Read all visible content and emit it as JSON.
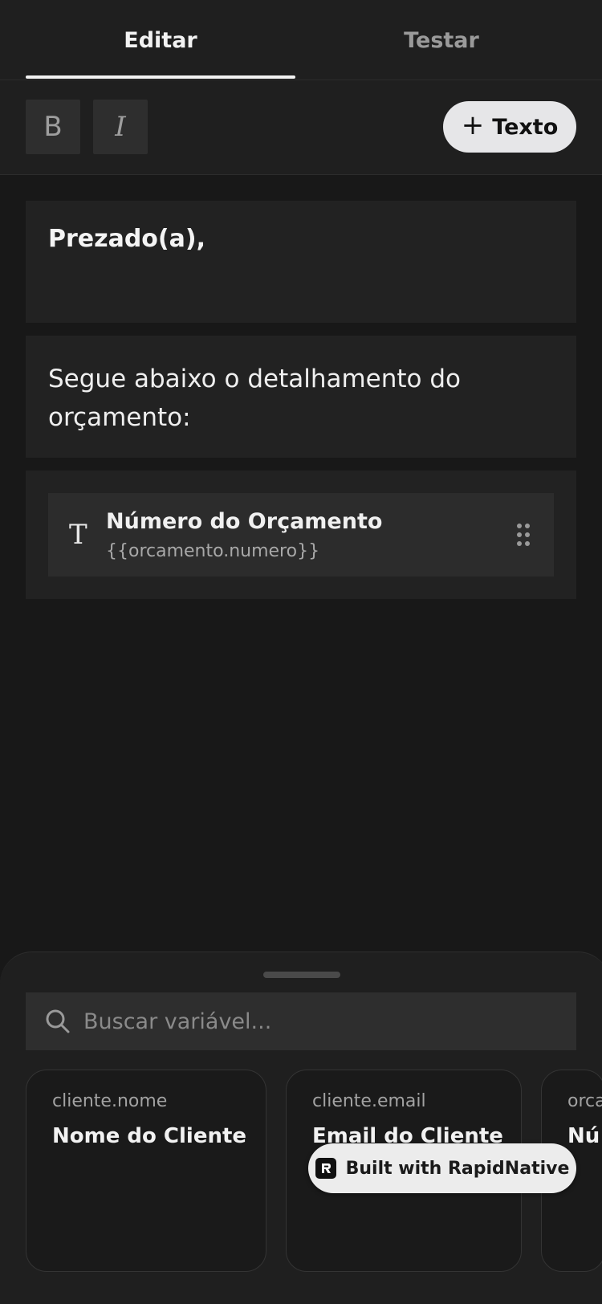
{
  "tabs": [
    {
      "label": "Editar",
      "active": true
    },
    {
      "label": "Testar",
      "active": false
    }
  ],
  "toolbar": {
    "bold_label": "B",
    "italic_label": "I",
    "add_text_label": "Texto",
    "add_text_icon": "plus-icon"
  },
  "blocks": {
    "greeting": "Prezado(a),",
    "intro": "Segue abaixo o detalhamento do orçamento:",
    "variable": {
      "icon": "text-t-icon",
      "label": "Número do Orçamento",
      "path": "{{orcamento.numero}}"
    }
  },
  "sheet": {
    "search_placeholder": "Buscar variável...",
    "cards": [
      {
        "path": "cliente.nome",
        "label": "Nome do Cliente"
      },
      {
        "path": "cliente.email",
        "label": "Email do Cliente"
      },
      {
        "path": "orca",
        "label": "Nú"
      }
    ]
  },
  "badge": {
    "label": "Built with RapidNative"
  },
  "colors": {
    "background": "#181818",
    "surface": "#222222",
    "accent_pill": "#e6e6e8",
    "muted_text": "#9a9a9a"
  }
}
